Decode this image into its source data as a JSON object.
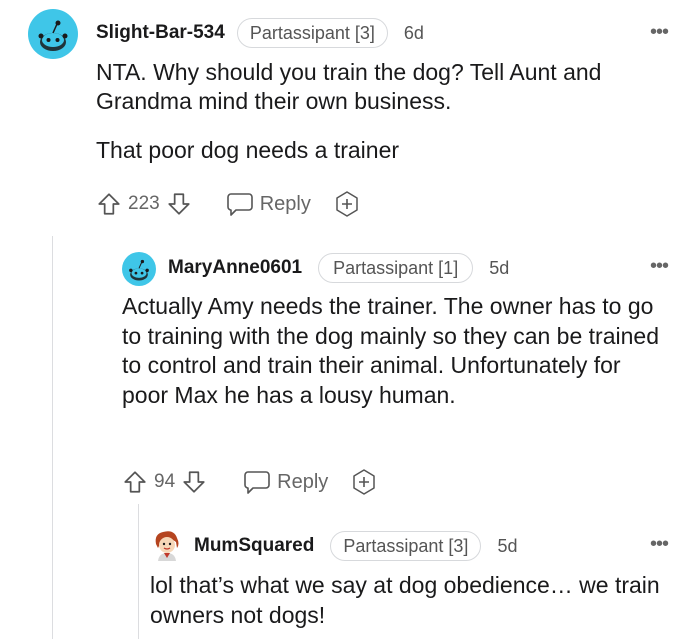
{
  "comments": [
    {
      "username": "Slight-Bar-534",
      "flair": "Partassipant [3]",
      "age": "6d",
      "paragraphs": [
        "NTA. Why should you train the dog? Tell Aunt and Grandma mind their own business.",
        "That poor dog needs a trainer"
      ],
      "score": "223",
      "reply_label": "Reply",
      "avatar_color": "#3fc6e8"
    },
    {
      "username": "MaryAnne0601",
      "flair": "Partassipant [1]",
      "age": "5d",
      "paragraphs": [
        "Actually Amy needs the trainer. The owner has to go to training with the dog mainly so they can be trained to control and train their animal. Unfortunately for poor Max he has a lousy human."
      ],
      "score": "94",
      "reply_label": "Reply",
      "avatar_color": "#3fc6e8"
    },
    {
      "username": "MumSquared",
      "flair": "Partassipant [3]",
      "age": "5d",
      "paragraphs": [
        "lol that’s what we say at dog obedience… we train owners not dogs!"
      ]
    }
  ],
  "icons": {
    "upvote": "upvote-icon",
    "downvote": "downvote-icon",
    "reply": "comment-bubble-icon",
    "award": "award-plus-icon",
    "more": "more-options-icon"
  }
}
